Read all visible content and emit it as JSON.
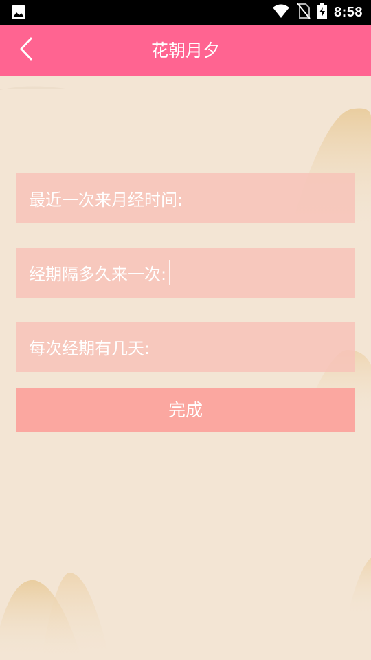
{
  "status_bar": {
    "time": "8:58",
    "icons": [
      "image-icon",
      "wifi-icon",
      "no-sim-icon",
      "battery-charging-icon"
    ]
  },
  "header": {
    "title": "花朝月夕",
    "back_icon": "chevron-left-icon"
  },
  "form": {
    "fields": [
      {
        "label": "最近一次来月经时间:",
        "value": ""
      },
      {
        "label": "经期隔多久来一次:",
        "value": ""
      },
      {
        "label": "每次经期有几天:",
        "value": ""
      }
    ],
    "submit_label": "完成"
  },
  "colors": {
    "accent": "#ff6491",
    "background": "#f3e5d4",
    "field_bg": "#f7c3b9",
    "button_bg": "#fba7a0"
  }
}
